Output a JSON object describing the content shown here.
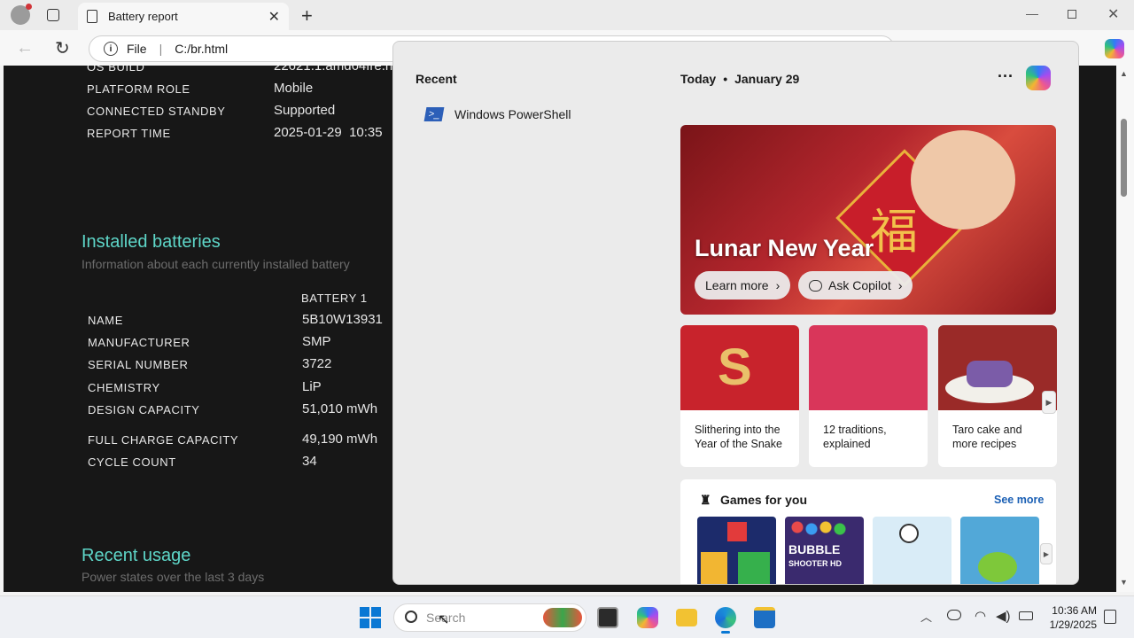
{
  "browser": {
    "tab_title": "Battery report",
    "address_scheme": "File",
    "address_path": "C:/br.html"
  },
  "report": {
    "system_rows": [
      {
        "label": "OS BUILD",
        "value": "22621.1.amd64fre.n"
      },
      {
        "label": "PLATFORM ROLE",
        "value": "Mobile"
      },
      {
        "label": "CONNECTED STANDBY",
        "value": "Supported"
      },
      {
        "label": "REPORT TIME",
        "value": "2025-01-29  10:35"
      }
    ],
    "installed_title": "Installed batteries",
    "installed_subtitle": "Information about each currently installed battery",
    "battery_col": "BATTERY 1",
    "battery_rows": [
      {
        "label": "NAME",
        "value": "5B10W13931"
      },
      {
        "label": "MANUFACTURER",
        "value": "SMP"
      },
      {
        "label": "SERIAL NUMBER",
        "value": "3722"
      },
      {
        "label": "CHEMISTRY",
        "value": "LiP"
      },
      {
        "label": "DESIGN CAPACITY",
        "value": "51,010 mWh"
      },
      {
        "label": "FULL CHARGE CAPACITY",
        "value": "49,190 mWh"
      },
      {
        "label": "CYCLE COUNT",
        "value": "34"
      }
    ],
    "usage_title": "Recent usage",
    "usage_subtitle": "Power states over the last 3 days"
  },
  "flyout": {
    "recent_heading": "Recent",
    "recent_items": [
      {
        "label": "Windows PowerShell",
        "icon": "powershell-icon"
      }
    ],
    "today_label": "Today",
    "date_label": "January 29",
    "hero_title": "Lunar New Year",
    "hero_glyph": "福",
    "learn_more": "Learn more",
    "ask_copilot": "Ask Copilot",
    "cards": [
      {
        "caption": "Slithering into the Year of the Snake",
        "color": "#c8232c"
      },
      {
        "caption": "12 traditions, explained",
        "color": "#d9365a"
      },
      {
        "caption": "Taro cake and more recipes",
        "color": "#9a2a28"
      }
    ],
    "games_title": "Games for you",
    "see_more": "See more",
    "games": [
      {
        "name": "tetris",
        "color": "#1c2b6b"
      },
      {
        "name": "Bubble Shooter HD",
        "color": "#3a2a6e"
      },
      {
        "name": "thief puzzle",
        "color": "#d9ecf7"
      },
      {
        "name": "Cut the Rope",
        "color": "#52a8d8"
      }
    ]
  },
  "taskbar": {
    "search_placeholder": "Search",
    "time": "10:36 AM",
    "date": "1/29/2025"
  }
}
